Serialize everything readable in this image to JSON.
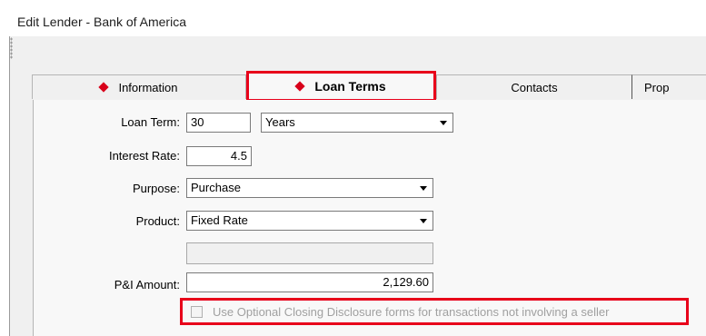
{
  "window": {
    "title": "Edit Lender - Bank of America"
  },
  "tabs": [
    {
      "label": "Information",
      "active": false,
      "icon": "red-diamond-icon"
    },
    {
      "label": "Loan Terms",
      "active": true,
      "icon": "red-diamond-icon"
    },
    {
      "label": "Contacts",
      "active": false
    },
    {
      "label": "Prop",
      "active": false
    }
  ],
  "form": {
    "loan_term": {
      "label": "Loan Term:",
      "value": "30",
      "unit": "Years"
    },
    "interest_rate": {
      "label": "Interest Rate:",
      "value": "4.5"
    },
    "purpose": {
      "label": "Purpose:",
      "value": "Purchase"
    },
    "product": {
      "label": "Product:",
      "value": "Fixed Rate"
    },
    "extra": {
      "value": ""
    },
    "pi_amount": {
      "label": "P&I Amount:",
      "value": "2,129.60"
    },
    "optional_cd": {
      "label": "Use Optional Closing Disclosure forms for transactions not involving a seller",
      "checked": false,
      "enabled": false
    }
  },
  "colors": {
    "highlight": "#e8001a",
    "diamond": "#d8001a",
    "panel": "#f8f8f8",
    "frame": "#f0f0f0"
  }
}
